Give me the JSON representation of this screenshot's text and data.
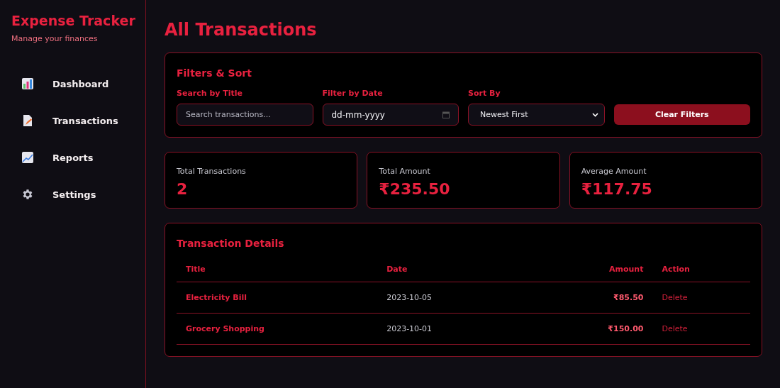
{
  "sidebar": {
    "title": "Expense Tracker",
    "subtitle": "Manage your finances",
    "items": [
      {
        "label": "Dashboard",
        "kind": "chart"
      },
      {
        "label": "Transactions",
        "kind": "document"
      },
      {
        "label": "Reports",
        "kind": "trend"
      },
      {
        "label": "Settings",
        "kind": "gear"
      }
    ]
  },
  "page_title": "All Transactions",
  "filters": {
    "title": "Filters & Sort",
    "search": {
      "label": "Search by Title",
      "placeholder": "Search transactions..."
    },
    "date": {
      "label": "Filter by Date",
      "value": "dd-mm-yyyy"
    },
    "sort": {
      "label": "Sort By",
      "value": "Newest First"
    },
    "clear_button": "Clear Filters"
  },
  "stats": [
    {
      "label": "Total Transactions",
      "value": "2"
    },
    {
      "label": "Total Amount",
      "value": "₹235.50"
    },
    {
      "label": "Average Amount",
      "value": "₹117.75"
    }
  ],
  "table": {
    "title": "Transaction Details",
    "columns": [
      "Title",
      "Date",
      "Amount",
      "Action"
    ],
    "rows": [
      {
        "title": "Electricity Bill",
        "date": "2023-10-05",
        "amount": "₹85.50",
        "action": "Delete"
      },
      {
        "title": "Grocery Shopping",
        "date": "2023-10-01",
        "amount": "₹150.00",
        "action": "Delete"
      }
    ]
  }
}
